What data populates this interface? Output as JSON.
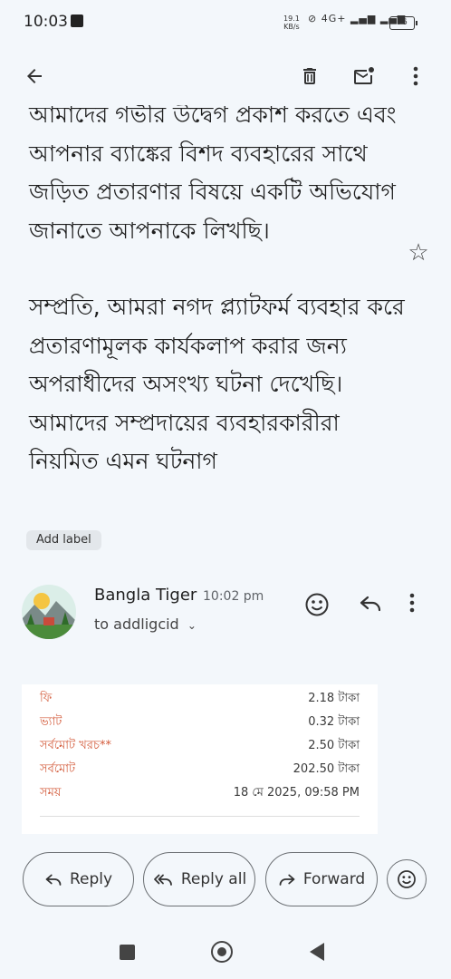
{
  "status_bar": {
    "time": "10:03",
    "net_speed_value": "19.1",
    "net_speed_unit": "KB/s",
    "network_label": "4G+",
    "battery": "76"
  },
  "toolbar": {
    "icons": [
      "back-arrow-icon",
      "trash-icon",
      "mark-unread-icon",
      "more-vert-icon"
    ]
  },
  "email": {
    "paragraph1": "আমাদের গভীর উদ্বেগ প্রকাশ করতে এবং আপনার ব্যাঙ্কের বিশদ ব্যবহারের সাথে জড়িত প্রতারণার বিষয়ে একটি অভিযোগ জানাতে আপনাকে লিখছি।",
    "paragraph2": "সম্প্রতি, আমরা নগদ প্ল্যাটফর্ম ব্যবহার করে প্রতারণামূলক কার্যকলাপ করার জন্য অপরাধীদের অসংখ্য ঘটনা দেখেছি। আমাদের সম্প্রদায়ের ব্যবহারকারীরা নিয়মিত এমন ঘটনাগ",
    "add_label": "Add label",
    "sender": "Bangla Tiger",
    "time": "10:02 pm",
    "to": "to addligcid"
  },
  "receipt": {
    "rows": [
      {
        "label": "ফি",
        "value": "2.18 টাকা"
      },
      {
        "label": "ভ্যাট",
        "value": "0.32 টাকা"
      },
      {
        "label": "সর্বমোট খরচ**",
        "value": "2.50 টাকা"
      },
      {
        "label": "সর্বমোট",
        "value": "202.50 টাকা"
      },
      {
        "label": "সময়",
        "value": "18 মে 2025, 09:58 PM"
      }
    ]
  },
  "actions": {
    "reply": "Reply",
    "reply_all": "Reply all",
    "forward": "Forward"
  },
  "colors": {
    "background": "#f3f7fb",
    "receipt_label": "#d35a3a"
  }
}
